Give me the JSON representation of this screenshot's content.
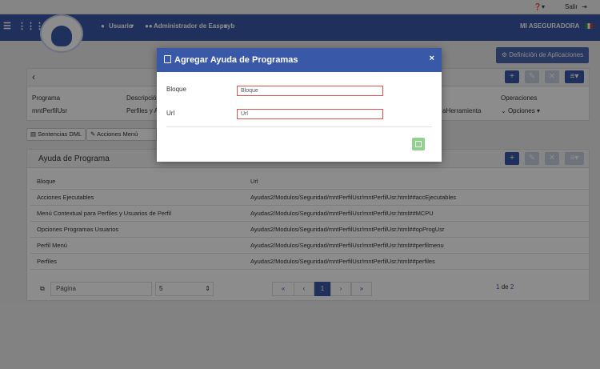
{
  "topbar": {
    "salir": "Salir"
  },
  "navbar": {
    "usuario": "Usuario",
    "admin": "Administrador de Easpayb",
    "company": "MI ASEGURADORA"
  },
  "def_button": "Definición de Aplicaciones",
  "header_panel": {
    "col_programa": "Programa",
    "col_descripcion": "Descripción",
    "val_programa": "mntPerfilUsr",
    "val_descripcion": "Perfiles y Ac",
    "val_herramienta": "aHerramienta",
    "col_operaciones": "Operaciones",
    "val_operaciones": "Opciones"
  },
  "tabs": {
    "tab1": "Sentencias DML",
    "tab2": "Acciones Menú Emerge"
  },
  "ayuda_panel": {
    "title": "Ayuda de Programa",
    "col_bloque": "Bloque",
    "col_url": "Url",
    "rows": [
      {
        "bloque": "Acciones Ejecutables",
        "url": "Ayudas2/Modulos/Seguridad/mntPerfilUsr/mntPerfilUsr.html##accEjecutables"
      },
      {
        "bloque": "Menú Contextual para Perfiles y Usuarios de Perfil",
        "url": "Ayudas2/Modulos/Seguridad/mntPerfilUsr/mntPerfilUsr.html##MCPU"
      },
      {
        "bloque": "Opciones Programas Usuarios",
        "url": "Ayudas2/Modulos/Seguridad/mntPerfilUsr/mntPerfilUsr.html##opProgUsr"
      },
      {
        "bloque": "Perfil Menú",
        "url": "Ayudas2/Modulos/Seguridad/mntPerfilUsr/mntPerfilUsr.html##perfilmenu"
      },
      {
        "bloque": "Perfiles",
        "url": "Ayudas2/Modulos/Seguridad/mntPerfilUsr/mntPerfilUsr.html##perfiles"
      }
    ]
  },
  "pagination": {
    "pagina_label": "Página",
    "page_size": "5",
    "first": "«",
    "prev": "‹",
    "current": "1",
    "next": "›",
    "last": "»",
    "summary_current": "1",
    "summary_de": "de",
    "summary_total": "2"
  },
  "modal": {
    "title": "Agregar Ayuda de Programas",
    "close": "×",
    "bloque_label": "Bloque",
    "bloque_value": "Bloque",
    "url_label": "Url",
    "url_value": "Url"
  }
}
